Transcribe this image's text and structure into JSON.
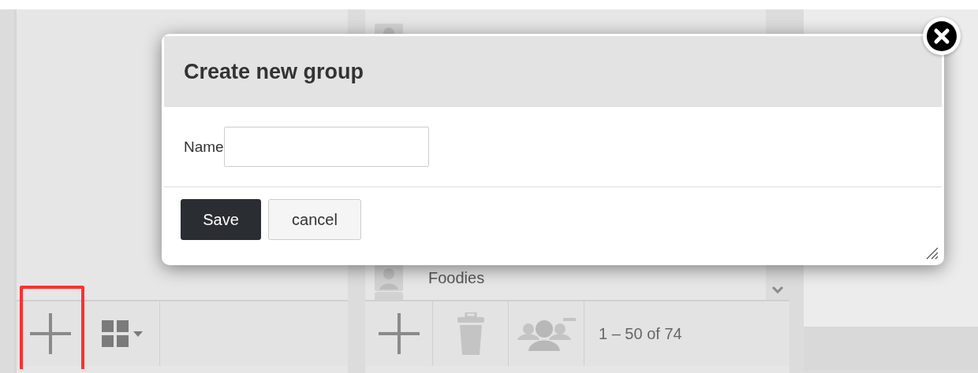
{
  "left_toolbar": {
    "add_button_highlighted": true
  },
  "group_list": {
    "items": [
      {
        "name": "Foodies"
      }
    ]
  },
  "middle_toolbar": {
    "pagination": "1 – 50 of 74"
  },
  "dialog": {
    "title": "Create new group",
    "name_label": "Name",
    "buttons": [
      {
        "label": "Save",
        "kind": "primary"
      },
      {
        "label": "cancel",
        "kind": "secondary"
      }
    ]
  }
}
